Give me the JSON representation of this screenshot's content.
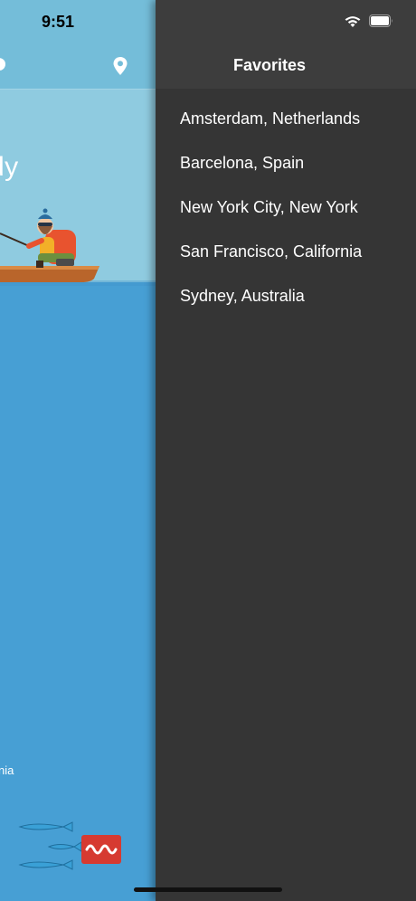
{
  "status_bar": {
    "time": "9:51"
  },
  "left_screen": {
    "weather_word": "dy",
    "location_fragment": "nia"
  },
  "drawer": {
    "title": "Favorites",
    "items": [
      {
        "label": "Amsterdam, Netherlands"
      },
      {
        "label": "Barcelona, Spain"
      },
      {
        "label": "New York City, New York"
      },
      {
        "label": "San Francisco, California"
      },
      {
        "label": "Sydney, Australia"
      }
    ]
  },
  "colors": {
    "sky": "#8fcbe0",
    "sea": "#479fd4",
    "drawer_bg": "#353535",
    "logo_red": "#d63a31"
  },
  "icons": [
    "location-pin-icon",
    "wifi-icon",
    "battery-icon",
    "fish-icon",
    "wm-logo-icon"
  ]
}
